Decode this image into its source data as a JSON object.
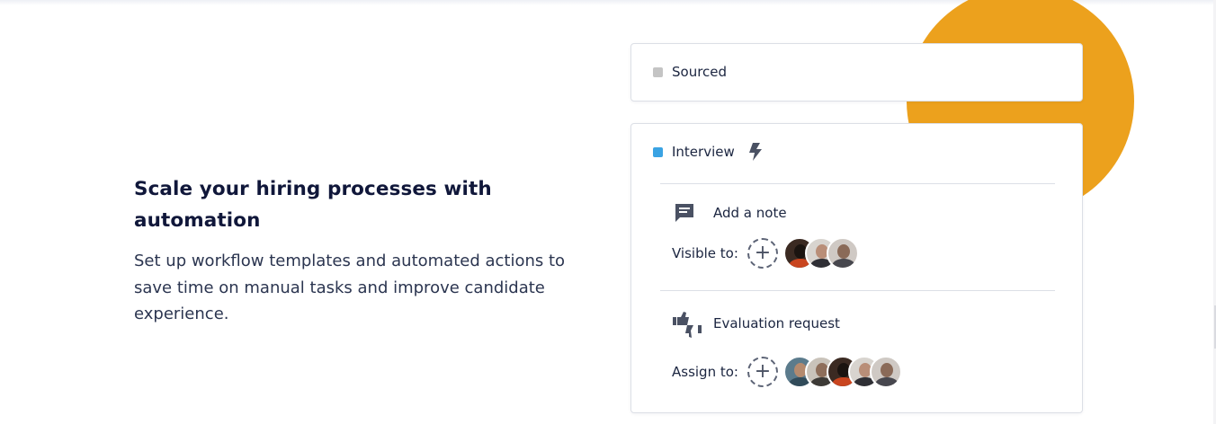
{
  "section": {
    "heading": "Scale your hiring processes with automation",
    "description": "Set up workflow templates and automated actions to save time on manual tasks and improve candidate experience."
  },
  "colors": {
    "accent_circle": "#eca11d",
    "sourced_square": "#c4c4c4",
    "interview_square": "#3aa3e3",
    "heading": "#10173a"
  },
  "pipeline": {
    "sourced": {
      "label": "Sourced",
      "icon": "gray-square"
    },
    "interview": {
      "label": "Interview",
      "automation_icon": "lightning-bolt-icon",
      "actions": [
        {
          "label": "Add a note",
          "icon": "comment-icon",
          "people_label": "Visible to:",
          "avatars": [
            "avatar-1",
            "avatar-2",
            "avatar-3"
          ]
        },
        {
          "label": "Evaluation request",
          "icon": "thumbs-up-down-icon",
          "people_label": "Assign to:",
          "avatars": [
            "avatar-1",
            "avatar-2",
            "avatar-3",
            "avatar-4",
            "avatar-5"
          ]
        }
      ]
    }
  },
  "add_person_glyph": "+"
}
